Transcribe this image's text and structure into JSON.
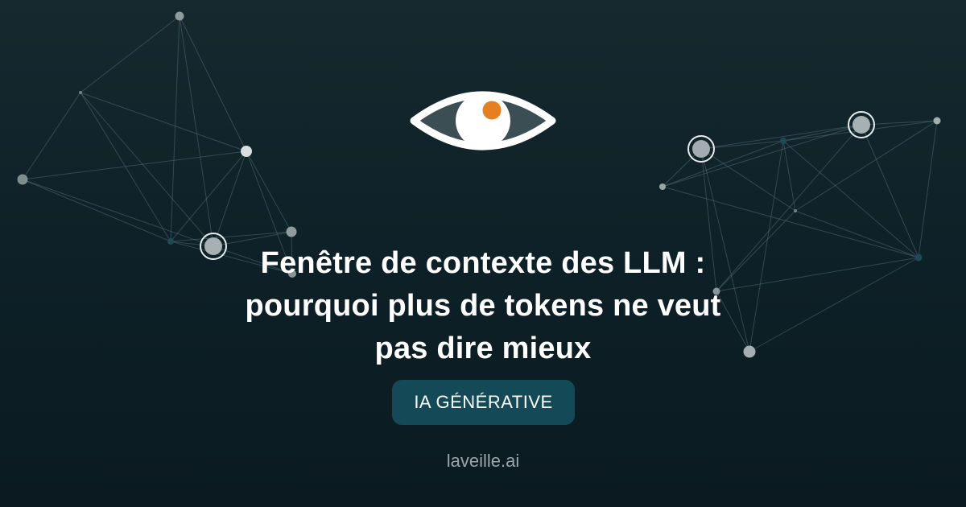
{
  "article": {
    "title": "Fenêtre de contexte des LLM : pourquoi plus de tokens ne veut pas dire mieux",
    "category": "IA GÉNÉRATIVE",
    "site": "laveille.ai"
  },
  "logo": {
    "icon": "eye-icon",
    "colors": {
      "outline": "#ffffff",
      "iris": "#3a4e53",
      "pupil": "#ffffff",
      "dot": "#e67e22"
    }
  },
  "colors": {
    "background_top": "#15292f",
    "background_bottom": "#0a1a20",
    "badge_background": "#144a58",
    "site_text": "#9aa6aa"
  }
}
